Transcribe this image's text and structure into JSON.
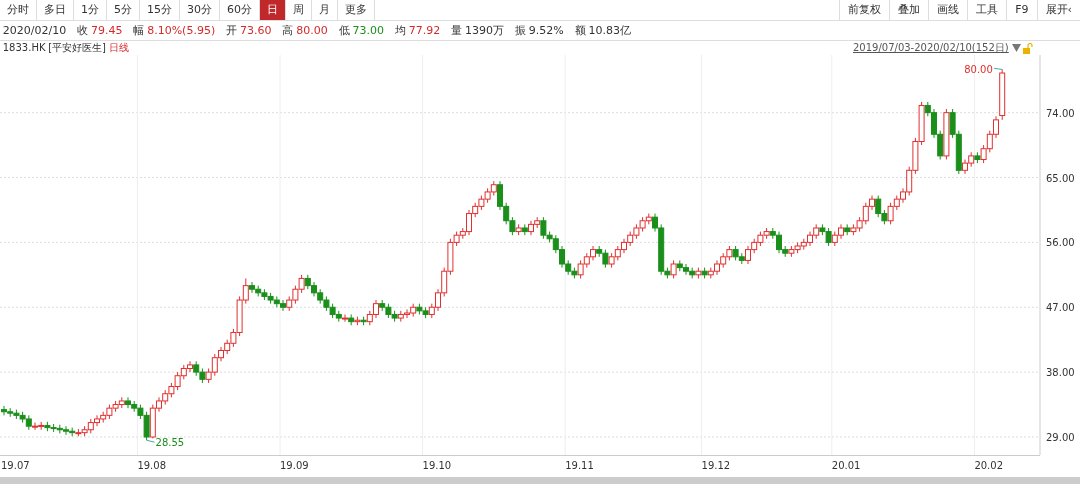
{
  "period_tabs": [
    {
      "label": "分时",
      "selected": false
    },
    {
      "label": "多日",
      "selected": false
    },
    {
      "label": "1分",
      "selected": false
    },
    {
      "label": "5分",
      "selected": false
    },
    {
      "label": "15分",
      "selected": false
    },
    {
      "label": "30分",
      "selected": false
    },
    {
      "label": "60分",
      "selected": false
    },
    {
      "label": "日",
      "selected": true
    },
    {
      "label": "周",
      "selected": false
    },
    {
      "label": "月",
      "selected": false
    },
    {
      "label": "更多",
      "selected": false
    }
  ],
  "tool_buttons": [
    "前复权",
    "叠加",
    "画线",
    "工具",
    "F9",
    "展开‹"
  ],
  "quote": {
    "date": "2020/02/10",
    "fields": [
      {
        "label": "收",
        "value": "79.45",
        "color": "#d42a2a"
      },
      {
        "label": "幅",
        "value": "8.10%(5.95)",
        "color": "#d42a2a"
      },
      {
        "label": "开",
        "value": "73.60",
        "color": "#d42a2a"
      },
      {
        "label": "高",
        "value": "80.00",
        "color": "#d42a2a"
      },
      {
        "label": "低",
        "value": "73.00",
        "color": "#1a8f1a"
      },
      {
        "label": "均",
        "value": "77.92",
        "color": "#d42a2a"
      },
      {
        "label": "量",
        "value": "1390万",
        "color": "#333333"
      },
      {
        "label": "振",
        "value": "9.52%",
        "color": "#333333"
      },
      {
        "label": "额",
        "value": "10.83亿",
        "color": "#333333"
      }
    ]
  },
  "stock": {
    "code": "1833.HK",
    "name": "[平安好医生]",
    "period": "日线",
    "range": "2019/07/03-2020/02/10(152日)"
  },
  "chart": {
    "chart_data": {
      "type": "candlestick",
      "grid": true,
      "ylim": [
        26.5,
        82
      ],
      "yticks": [
        {
          "value": 29,
          "label": "29.00"
        },
        {
          "value": 38,
          "label": "38.00"
        },
        {
          "value": 47,
          "label": "47.00"
        },
        {
          "value": 56,
          "label": "56.00"
        },
        {
          "value": 65,
          "label": "65.00"
        },
        {
          "value": 74,
          "label": "74.00"
        }
      ],
      "ohlc": [
        [
          32.8,
          33.3,
          32,
          32.5
        ],
        [
          32.5,
          33,
          31.8,
          32.3
        ],
        [
          32.3,
          32.8,
          31.5,
          32
        ],
        [
          32,
          32.5,
          31,
          31.5
        ],
        [
          31.5,
          32,
          30,
          30.5
        ],
        [
          30.5,
          31,
          30,
          30.5
        ],
        [
          30.5,
          31.1,
          30,
          30.6
        ],
        [
          30.6,
          31.1,
          29.8,
          30.3
        ],
        [
          30.3,
          30.8,
          29.7,
          30.2
        ],
        [
          30.2,
          30.7,
          29.5,
          30
        ],
        [
          30,
          30.5,
          29.3,
          29.8
        ],
        [
          29.8,
          30.3,
          29.1,
          29.6
        ],
        [
          29.6,
          30.1,
          29.1,
          29.6
        ],
        [
          29.6,
          30.5,
          29.1,
          30
        ],
        [
          30,
          31.5,
          29.5,
          31
        ],
        [
          31,
          32,
          30.5,
          31.5
        ],
        [
          31.5,
          32.5,
          31,
          32
        ],
        [
          32,
          33.5,
          31.5,
          33
        ],
        [
          33,
          34,
          32.5,
          33.5
        ],
        [
          33.5,
          34.5,
          33,
          34
        ],
        [
          34,
          34.5,
          33,
          33.5
        ],
        [
          33.5,
          34,
          32.5,
          33
        ],
        [
          33,
          33.5,
          31.5,
          32
        ],
        [
          32,
          32.5,
          28.55,
          29
        ],
        [
          29,
          33.5,
          28.8,
          33
        ],
        [
          33,
          34.5,
          32.5,
          34
        ],
        [
          34,
          35.5,
          33.5,
          35
        ],
        [
          35,
          36.5,
          34.5,
          36
        ],
        [
          36,
          38,
          35.5,
          37.5
        ],
        [
          37.5,
          39,
          37,
          38.5
        ],
        [
          38.5,
          39.5,
          38,
          39
        ],
        [
          39,
          39.5,
          37.5,
          38
        ],
        [
          38,
          38.5,
          36.5,
          37
        ],
        [
          37,
          38.5,
          36.5,
          38
        ],
        [
          38,
          40.5,
          37.5,
          40
        ],
        [
          40,
          41.5,
          39.5,
          41
        ],
        [
          41,
          42.5,
          40.5,
          42
        ],
        [
          42,
          44,
          41.5,
          43.5
        ],
        [
          43.5,
          48.5,
          43,
          48
        ],
        [
          48,
          51,
          47.5,
          50
        ],
        [
          50,
          50.5,
          49,
          49.5
        ],
        [
          49.5,
          50,
          48.5,
          49
        ],
        [
          49,
          49.5,
          48,
          48.5
        ],
        [
          48.5,
          49,
          47.5,
          48
        ],
        [
          48,
          48.5,
          47,
          47.5
        ],
        [
          47.5,
          48,
          46.5,
          47
        ],
        [
          47,
          48.5,
          46.5,
          48
        ],
        [
          48,
          50,
          47.5,
          49.5
        ],
        [
          49.5,
          51.5,
          49,
          51
        ],
        [
          51,
          51.5,
          49.5,
          50
        ],
        [
          50,
          50.5,
          48.5,
          49
        ],
        [
          49,
          49.5,
          47.5,
          48
        ],
        [
          48,
          48.5,
          46.5,
          47
        ],
        [
          47,
          47.5,
          45.5,
          46
        ],
        [
          46,
          46.5,
          45,
          45.5
        ],
        [
          45.5,
          46,
          45,
          45.5
        ],
        [
          45.5,
          46,
          44.5,
          45
        ],
        [
          45,
          45.7,
          44.5,
          45.2
        ],
        [
          45.2,
          45.7,
          44.5,
          45
        ],
        [
          45,
          46.5,
          44.5,
          46
        ],
        [
          46,
          48,
          45.5,
          47.5
        ],
        [
          47.5,
          48,
          46.5,
          47
        ],
        [
          47,
          47.5,
          45.5,
          46
        ],
        [
          46,
          46.5,
          45,
          45.5
        ],
        [
          45.5,
          46.5,
          45,
          46
        ],
        [
          46,
          46.7,
          45.5,
          46.2
        ],
        [
          46.2,
          47.5,
          45.7,
          47
        ],
        [
          47,
          47.5,
          46,
          46.5
        ],
        [
          46.5,
          47,
          45.5,
          46
        ],
        [
          46,
          47.5,
          45.5,
          47
        ],
        [
          47,
          49.5,
          46.5,
          49
        ],
        [
          49,
          52.5,
          48.5,
          52
        ],
        [
          52,
          56.5,
          51.5,
          56
        ],
        [
          56,
          57.5,
          55.5,
          57
        ],
        [
          57,
          58,
          56.5,
          57.5
        ],
        [
          57.5,
          60.5,
          57,
          60
        ],
        [
          60,
          61.5,
          59.5,
          61
        ],
        [
          61,
          62.5,
          60.5,
          62
        ],
        [
          62,
          63.5,
          61.5,
          63
        ],
        [
          63,
          64.5,
          62.5,
          64
        ],
        [
          64,
          64.5,
          60.5,
          61
        ],
        [
          61,
          61.5,
          58.5,
          59
        ],
        [
          59,
          59.5,
          57,
          57.5
        ],
        [
          57.5,
          58.5,
          57,
          58
        ],
        [
          58,
          58.5,
          57,
          57.5
        ],
        [
          57.5,
          59,
          57,
          58.5
        ],
        [
          58.5,
          59.5,
          58,
          59
        ],
        [
          59,
          59.5,
          56.5,
          57
        ],
        [
          57,
          57.5,
          56,
          56.5
        ],
        [
          56.5,
          57,
          54.5,
          55
        ],
        [
          55,
          55.5,
          52.5,
          53
        ],
        [
          53,
          53.5,
          51.5,
          52
        ],
        [
          52,
          52.5,
          51,
          51.5
        ],
        [
          51.5,
          53.5,
          51,
          53
        ],
        [
          53,
          54.5,
          52.5,
          54
        ],
        [
          54,
          55.5,
          53.5,
          55
        ],
        [
          55,
          55.5,
          54,
          54.5
        ],
        [
          54.5,
          55,
          52.5,
          53
        ],
        [
          53,
          54.5,
          52.5,
          54
        ],
        [
          54,
          55.5,
          53.5,
          55
        ],
        [
          55,
          56.5,
          54.5,
          56
        ],
        [
          56,
          57.5,
          55.5,
          57
        ],
        [
          57,
          58.5,
          56.5,
          58
        ],
        [
          58,
          59.5,
          57.5,
          59
        ],
        [
          59,
          60,
          58.5,
          59.5
        ],
        [
          59.5,
          60,
          57.5,
          58
        ],
        [
          58,
          58.5,
          51.5,
          52
        ],
        [
          52,
          52.5,
          51,
          51.5
        ],
        [
          51.5,
          53.5,
          51,
          53
        ],
        [
          53,
          53.5,
          52,
          52.5
        ],
        [
          52.5,
          53,
          51.5,
          52
        ],
        [
          52,
          52.5,
          51,
          51.5
        ],
        [
          51.5,
          52.5,
          51,
          52
        ],
        [
          52,
          52.5,
          51,
          51.5
        ],
        [
          51.5,
          52.5,
          51,
          52
        ],
        [
          52,
          53.5,
          51.5,
          53
        ],
        [
          53,
          54.5,
          52.5,
          54
        ],
        [
          54,
          55.5,
          53.5,
          55
        ],
        [
          55,
          55.5,
          53.5,
          54
        ],
        [
          54,
          54.5,
          53,
          53.5
        ],
        [
          53.5,
          55.5,
          53,
          55
        ],
        [
          55,
          56.5,
          54.5,
          56
        ],
        [
          56,
          57.5,
          55.5,
          57
        ],
        [
          57,
          58,
          56.5,
          57.5
        ],
        [
          57.5,
          58,
          56.5,
          57
        ],
        [
          57,
          57.5,
          54.5,
          55
        ],
        [
          55,
          55.5,
          54,
          54.5
        ],
        [
          54.5,
          55.5,
          54,
          55
        ],
        [
          55,
          56,
          54.5,
          55.5
        ],
        [
          55.5,
          56.5,
          55,
          56
        ],
        [
          56,
          57.5,
          55.5,
          57
        ],
        [
          57,
          58.5,
          56.5,
          58
        ],
        [
          58,
          58.5,
          57,
          57.5
        ],
        [
          57.5,
          58,
          55.5,
          56
        ],
        [
          56,
          57.5,
          55.5,
          57
        ],
        [
          57,
          58.5,
          56.5,
          58
        ],
        [
          58,
          58.5,
          57,
          57.5
        ],
        [
          57.5,
          58.5,
          57,
          58
        ],
        [
          58,
          59.5,
          57.5,
          59
        ],
        [
          59,
          61.5,
          58.5,
          61
        ],
        [
          61,
          62.5,
          60.5,
          62
        ],
        [
          62,
          62.5,
          59.5,
          60
        ],
        [
          60,
          60.5,
          58.5,
          59
        ],
        [
          59,
          61.5,
          58.5,
          61
        ],
        [
          61,
          62.5,
          60.5,
          62
        ],
        [
          62,
          63.5,
          61.5,
          63
        ],
        [
          63,
          66.5,
          62.5,
          66
        ],
        [
          66,
          70.5,
          65.5,
          70
        ],
        [
          70,
          75.5,
          69.5,
          75
        ],
        [
          75,
          75.5,
          73.5,
          74
        ],
        [
          74,
          74.5,
          70.5,
          71
        ],
        [
          71,
          71.5,
          67.5,
          68
        ],
        [
          68,
          74.5,
          67.5,
          74
        ],
        [
          74,
          74.5,
          70.5,
          71
        ],
        [
          71,
          71.5,
          65.5,
          66
        ],
        [
          66,
          67.5,
          65.5,
          67
        ],
        [
          67,
          68.5,
          66.5,
          68
        ],
        [
          68,
          68.5,
          67,
          67.5
        ],
        [
          67.5,
          69.5,
          67,
          69
        ],
        [
          69,
          71.5,
          68.5,
          71
        ],
        [
          71,
          73.5,
          70.5,
          73
        ],
        [
          73.6,
          80,
          73,
          79.5
        ]
      ],
      "annotations": [
        "28.55",
        "80.00"
      ]
    },
    "month_labels": [
      "19.07",
      "19.08",
      "19.09",
      "19.10",
      "19.11",
      "19.12",
      "20.01",
      "20.02"
    ]
  }
}
